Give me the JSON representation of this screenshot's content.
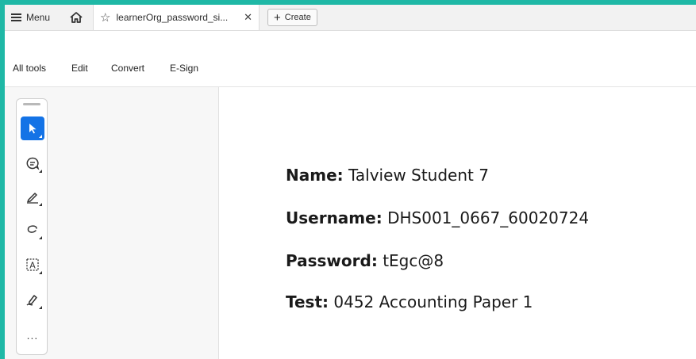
{
  "tabbar": {
    "menu_label": "Menu",
    "tab_title": "learnerOrg_password_si...",
    "create_label": "Create"
  },
  "menubar": {
    "items": [
      "All tools",
      "Edit",
      "Convert",
      "E-Sign"
    ]
  },
  "toolrail": {
    "tools": [
      "select-tool",
      "comment-tool",
      "highlight-tool",
      "draw-tool",
      "text-recognition-tool",
      "sign-tool"
    ],
    "more_label": "..."
  },
  "document": {
    "name_label": "Name:",
    "name_value": "Talview Student 7",
    "username_label": "Username:",
    "username_value": "DHS001_0667_60020724",
    "password_label": "Password:",
    "password_value": "tEgc@8",
    "test_label": "Test:",
    "test_value": "0452 Accounting Paper 1"
  },
  "colors": {
    "frame_accent": "#1fb8a6",
    "active_tool": "#1473e6"
  }
}
